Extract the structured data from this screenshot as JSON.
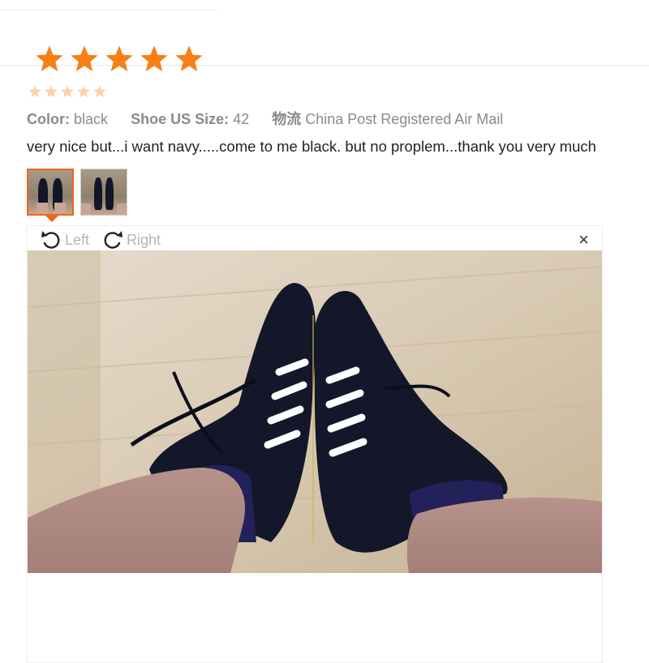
{
  "rating": {
    "stars": 5,
    "max": 5,
    "star_color": "#f77f14"
  },
  "review": {
    "attributes": [
      {
        "label": "Color:",
        "value": "black"
      },
      {
        "label": "Shoe US Size:",
        "value": "42"
      },
      {
        "label": "物流",
        "value": "China Post Registered Air Mail"
      }
    ],
    "text": "very nice but...i want navy.....come to me black. but no proplem...thank you very much"
  },
  "thumbnails": {
    "count": 2,
    "selected_index": 0,
    "selection_color": "#f0651c"
  },
  "viewer": {
    "rotate_left_label": "Left",
    "rotate_right_label": "Right",
    "close_label": "×",
    "icons": {
      "rotate_left": "rotate-left-icon",
      "rotate_right": "rotate-right-icon",
      "close": "close-icon"
    }
  },
  "colors": {
    "label_text": "#8a8a8a",
    "body_text": "#222222",
    "icon_gray": "#b5b5b5"
  }
}
